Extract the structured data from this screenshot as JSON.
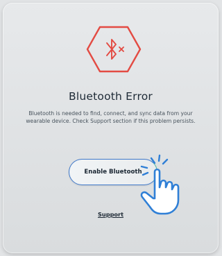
{
  "dialog": {
    "icon": "bluetooth-off-icon",
    "icon_color": "#e34b43",
    "title": "Bluetooth Error",
    "description_line1": "Bluetooth is needed to find, connect, and sync data from your",
    "description_line2": "wearable device. Check Support section if this problem persists.",
    "enable_button_label": "Enable Bluetooth",
    "support_link_label": "Support"
  },
  "overlay": {
    "pointer_icon": "tap-hand-icon",
    "accent_color": "#2f7fd6"
  }
}
